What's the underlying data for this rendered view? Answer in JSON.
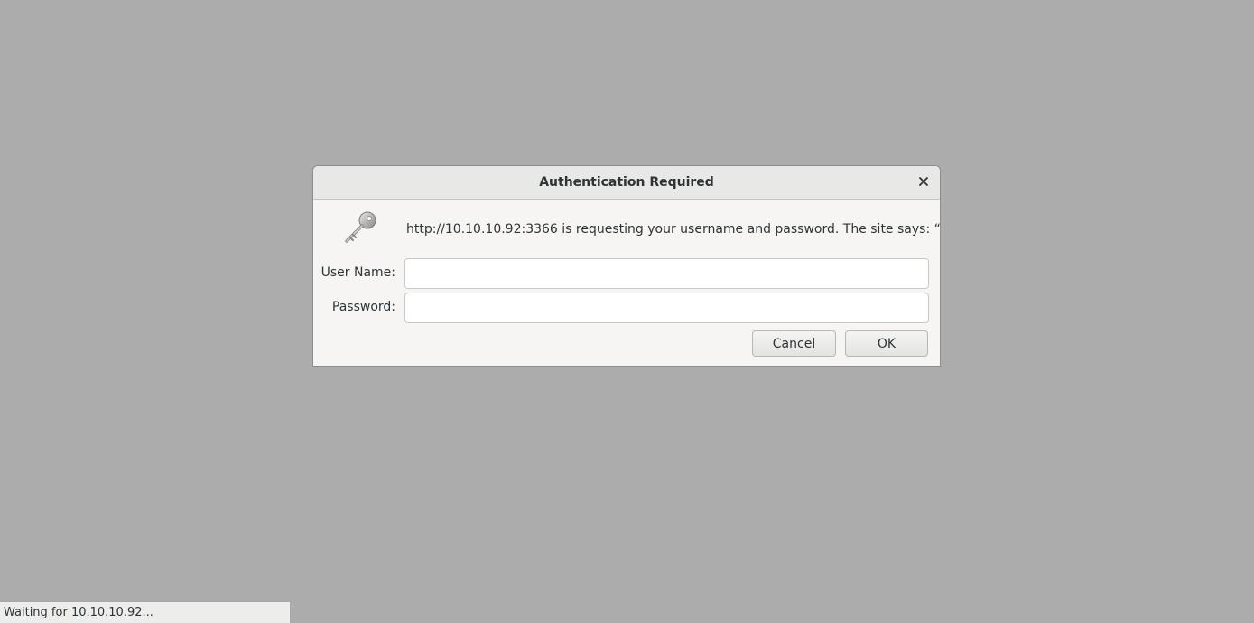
{
  "dialog": {
    "title": "Authentication Required",
    "close_icon": "close-icon",
    "key_icon": "key-icon",
    "message": "http://10.10.10.92:3366 is requesting your username and password. The site says: “Test”",
    "username_label": "User Name:",
    "username_value": "",
    "password_label": "Password:",
    "password_value": "",
    "cancel_label": "Cancel",
    "ok_label": "OK"
  },
  "statusbar": {
    "text": "Waiting for 10.10.10.92..."
  },
  "colors": {
    "backdrop": "#acacac",
    "dialog_bg": "#f6f5f4",
    "titlebar_bg": "#e8e8e7",
    "text": "#2e3436"
  }
}
